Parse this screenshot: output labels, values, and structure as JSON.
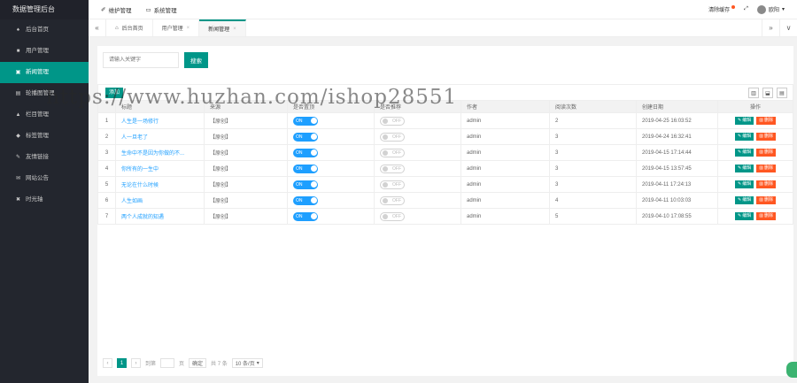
{
  "app": {
    "title": "数据管理后台"
  },
  "sidebar": {
    "items": [
      {
        "label": "后台首页",
        "icon": "home-icon",
        "glyph": "♠",
        "active": false
      },
      {
        "label": "用户管理",
        "icon": "user-icon",
        "glyph": "■",
        "active": false
      },
      {
        "label": "新闻管理",
        "icon": "news-icon",
        "glyph": "▣",
        "active": true
      },
      {
        "label": "轮播图管理",
        "icon": "carousel-icon",
        "glyph": "▤",
        "active": false
      },
      {
        "label": "栏目管理",
        "icon": "column-icon",
        "glyph": "▲",
        "active": false
      },
      {
        "label": "标签管理",
        "icon": "tag-icon",
        "glyph": "◆",
        "active": false
      },
      {
        "label": "友情链接",
        "icon": "link-icon",
        "glyph": "✎",
        "active": false
      },
      {
        "label": "网站公告",
        "icon": "notice-icon",
        "glyph": "✉",
        "active": false
      },
      {
        "label": "时光轴",
        "icon": "timeline-icon",
        "glyph": "✖",
        "active": false
      }
    ]
  },
  "header": {
    "nav": [
      {
        "label": "维护管理",
        "icon": "wrench-icon",
        "glyph": "✐"
      },
      {
        "label": "系统管理",
        "icon": "monitor-icon",
        "glyph": "▭"
      }
    ],
    "clear_cache": "清除缓存",
    "fullscreen_glyph": "⤢",
    "user_name": "欧阳"
  },
  "tabs": [
    {
      "label": "后台首页",
      "icon": "home-icon",
      "glyph": "⌂",
      "closable": false,
      "active": false
    },
    {
      "label": "用户管理",
      "closable": true,
      "active": false
    },
    {
      "label": "新闻管理",
      "closable": true,
      "active": true
    }
  ],
  "search": {
    "placeholder": "请输入关键字",
    "button": "搜索"
  },
  "toolbar": {
    "add": "添加"
  },
  "table": {
    "columns": [
      "",
      "标题",
      "来源",
      "是否置顶",
      "是否推荐",
      "作者",
      "阅读次数",
      "创建日期",
      "操作"
    ],
    "rows": [
      {
        "i": "1",
        "title": "人生是一场修行",
        "source": "【原创】",
        "top": "ON",
        "rec": "OFF",
        "author": "admin",
        "views": "2",
        "date": "2019-04-25 16:03:52"
      },
      {
        "i": "2",
        "title": "人一旦老了",
        "source": "【原创】",
        "top": "ON",
        "rec": "OFF",
        "author": "admin",
        "views": "3",
        "date": "2019-04-24 16:32:41"
      },
      {
        "i": "3",
        "title": "生命中不是因为你做的不...",
        "source": "【原创】",
        "top": "ON",
        "rec": "OFF",
        "author": "admin",
        "views": "3",
        "date": "2019-04-15 17:14:44"
      },
      {
        "i": "4",
        "title": "你所有的一生中",
        "source": "【原创】",
        "top": "ON",
        "rec": "OFF",
        "author": "admin",
        "views": "3",
        "date": "2019-04-15 13:57:45"
      },
      {
        "i": "5",
        "title": "无论在什么时候",
        "source": "【原创】",
        "top": "ON",
        "rec": "OFF",
        "author": "admin",
        "views": "3",
        "date": "2019-04-11 17:24:13"
      },
      {
        "i": "6",
        "title": "人生如画",
        "source": "【原创】",
        "top": "ON",
        "rec": "OFF",
        "author": "admin",
        "views": "4",
        "date": "2019-04-11 10:03:03"
      },
      {
        "i": "7",
        "title": "两个人成就的知遇",
        "source": "【原创】",
        "top": "ON",
        "rec": "OFF",
        "author": "admin",
        "views": "5",
        "date": "2019-04-10 17:08:55"
      }
    ],
    "edit_label": "编辑",
    "delete_label": "删除"
  },
  "pager": {
    "prev": "‹",
    "current": "1",
    "next": "›",
    "goto_label": "到第",
    "page_unit": "页",
    "confirm": "确定",
    "total": "共 7 条",
    "per_page": "10 条/页"
  },
  "watermark": "https://www.huzhan.com/ishop28551"
}
